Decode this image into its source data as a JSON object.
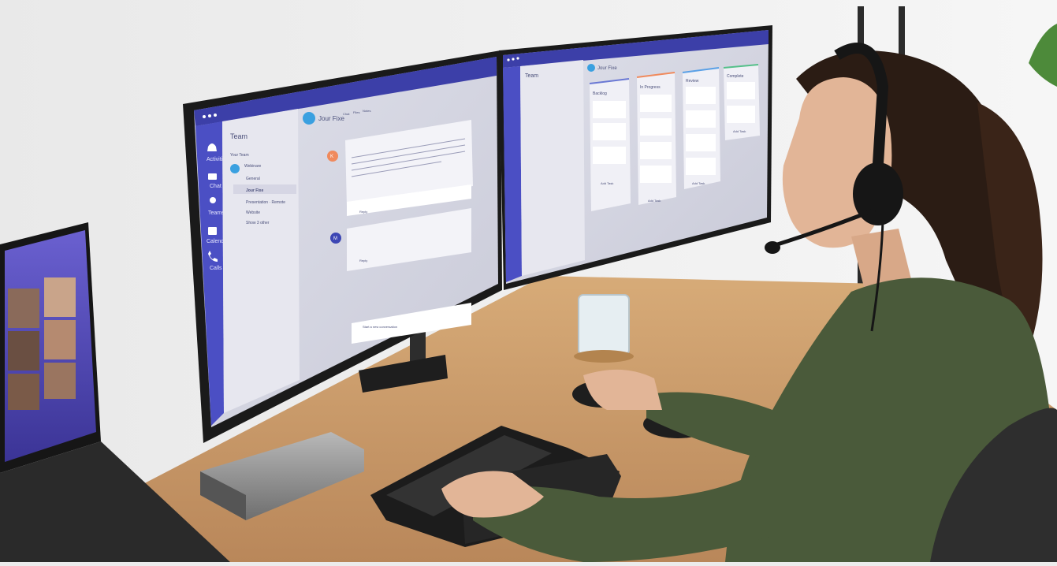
{
  "left_monitor": {
    "app_title": "Team",
    "your_team_label": "Your Team",
    "channel_title": "Jour Fixe",
    "tabs": [
      "Chat",
      "Files",
      "Notes"
    ],
    "nav_items": [
      {
        "label": "Activities",
        "icon": "bell-icon"
      },
      {
        "label": "Chat",
        "icon": "chat-icon"
      },
      {
        "label": "Teams",
        "icon": "people-icon"
      },
      {
        "label": "Calendar",
        "icon": "calendar-icon"
      },
      {
        "label": "Calls",
        "icon": "phone-icon"
      }
    ],
    "team_channels": [
      "Webinare",
      "General",
      "Jour Fixe",
      "Presentation · Remote",
      "Website",
      "Show 3 other"
    ],
    "messages": [
      {
        "avatar_letter": "K",
        "avatar_color": "#f08a5d"
      },
      {
        "avatar_letter": "M",
        "avatar_color": "#3c46b4"
      }
    ],
    "reply_label": "Reply",
    "compose_placeholder": "Start a new conversation"
  },
  "right_monitor": {
    "app_title": "Team",
    "channel_title": "Jour Fixe",
    "board_columns": [
      {
        "title": "Backlog",
        "accent": "#6a78d4",
        "add_label": "Add Task"
      },
      {
        "title": "In Progress",
        "accent": "#f08a5d",
        "add_label": "Add Task"
      },
      {
        "title": "Review",
        "accent": "#5aa0e6",
        "add_label": "Add Task"
      },
      {
        "title": "Complete",
        "accent": "#55c08a",
        "add_label": "Add Task"
      }
    ]
  },
  "laptop": {
    "screen_accent": "#4a3fb8"
  },
  "colors": {
    "brand_bar": "#3c3fa8",
    "sidebar": "#4b4fc4",
    "desk": "#c99a66",
    "sweater": "#4a5a3a",
    "wall": "#efefef"
  }
}
